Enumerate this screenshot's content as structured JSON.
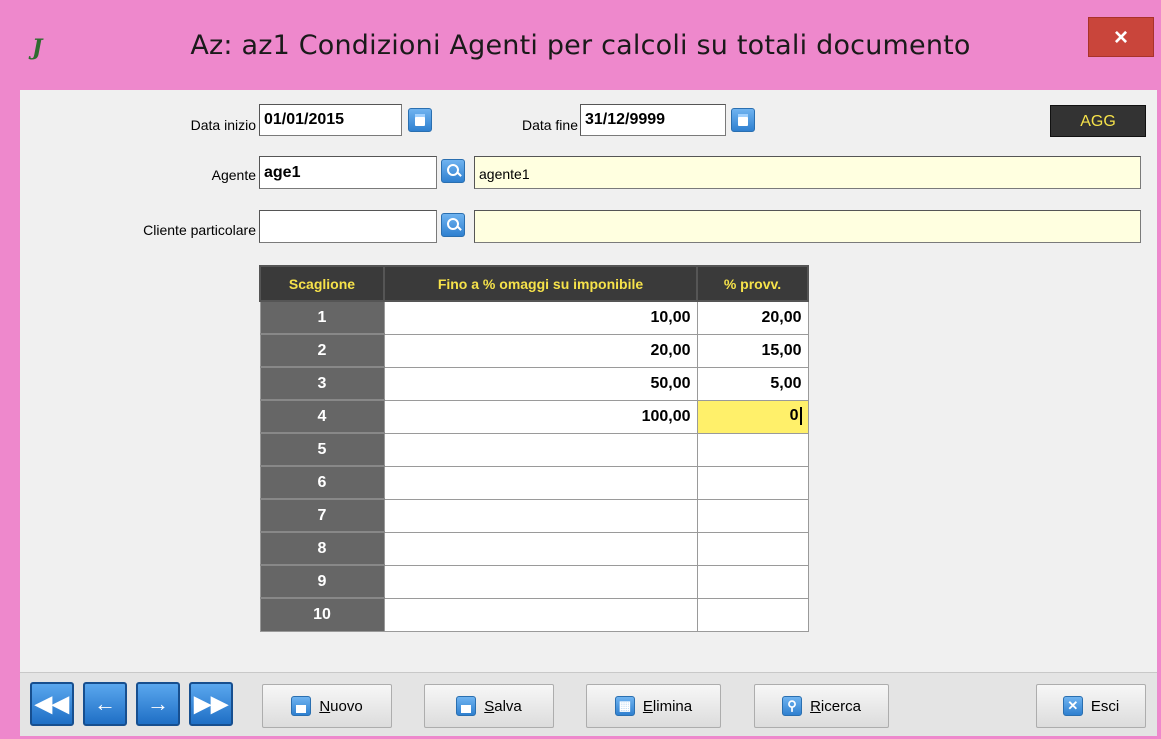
{
  "window": {
    "title": "Az: az1   Condizioni Agenti per calcoli su totali documento",
    "close_label": "×"
  },
  "form": {
    "data_inizio_label": "Data inizio",
    "data_inizio_value": "01/01/2015",
    "data_fine_label": "Data fine",
    "data_fine_value": "31/12/9999",
    "agg_label": "AGG",
    "agente_label": "Agente",
    "agente_code": "age1",
    "agente_desc": "agente1",
    "cliente_label": "Cliente particolare",
    "cliente_code": "",
    "cliente_desc": ""
  },
  "table": {
    "headers": [
      "Scaglione",
      "Fino a % omaggi su imponibile",
      "% provv."
    ],
    "rows": [
      {
        "num": "1",
        "fino": "10,00",
        "provv": "20,00"
      },
      {
        "num": "2",
        "fino": "20,00",
        "provv": "15,00"
      },
      {
        "num": "3",
        "fino": "50,00",
        "provv": "5,00"
      },
      {
        "num": "4",
        "fino": "100,00",
        "provv": "0"
      },
      {
        "num": "5",
        "fino": "",
        "provv": ""
      },
      {
        "num": "6",
        "fino": "",
        "provv": ""
      },
      {
        "num": "7",
        "fino": "",
        "provv": ""
      },
      {
        "num": "8",
        "fino": "",
        "provv": ""
      },
      {
        "num": "9",
        "fino": "",
        "provv": ""
      },
      {
        "num": "10",
        "fino": "",
        "provv": ""
      }
    ]
  },
  "toolbar": {
    "nuovo_first": "N",
    "nuovo_rest": "uovo",
    "salva_first": "S",
    "salva_rest": "alva",
    "elimina_first": "E",
    "elimina_rest": "limina",
    "ricerca_first": "R",
    "ricerca_rest": "icerca",
    "esci": "Esci"
  },
  "colors": {
    "window_frame": "#ee88cc",
    "header_bg": "#3a3a3a",
    "header_text": "#f6e24a",
    "active_cell": "#fff06a",
    "desc_field": "#ffffe0"
  }
}
